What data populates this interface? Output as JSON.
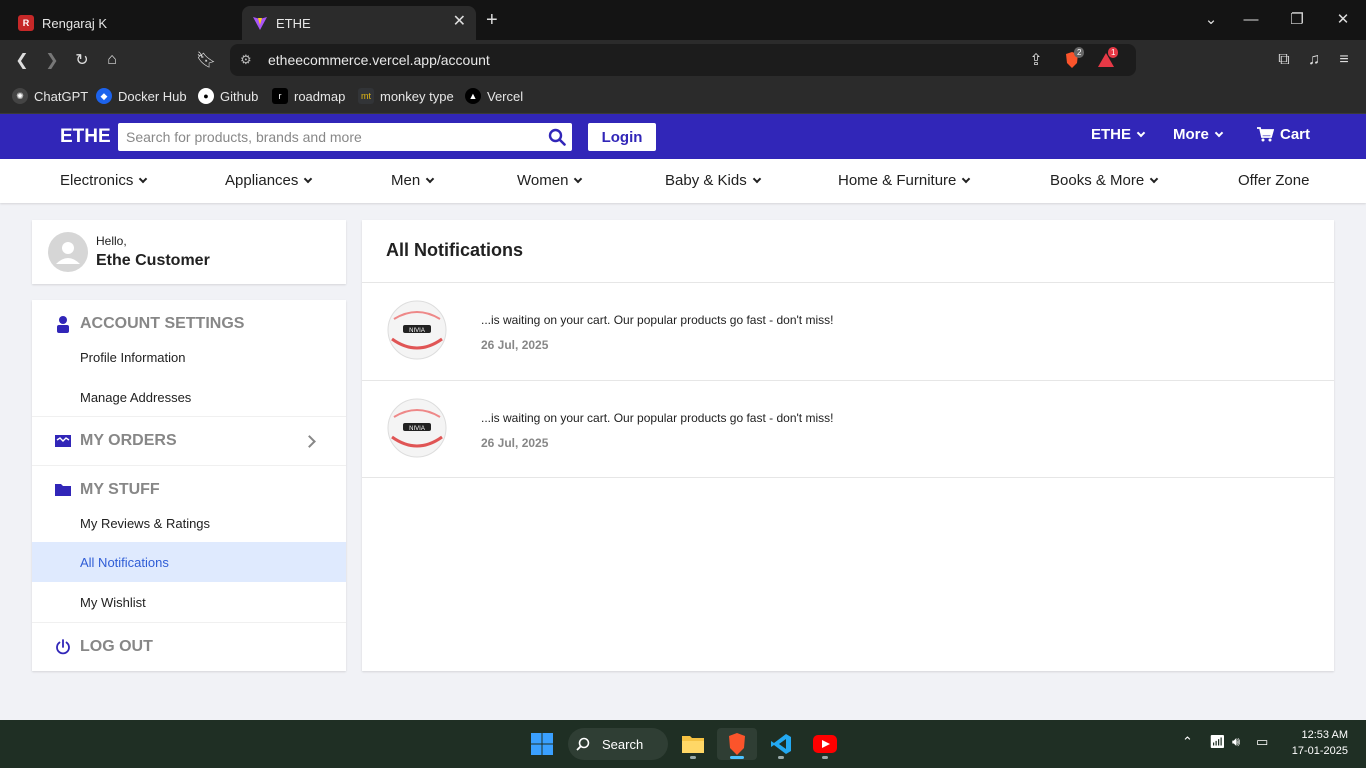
{
  "browser": {
    "tabs": [
      {
        "title": "Rengaraj K",
        "favicon": "red-r-icon"
      },
      {
        "title": "ETHE",
        "favicon": "vite-icon"
      }
    ],
    "url": "etheecommerce.vercel.app/account",
    "shields_count": "2",
    "rewards_count": "1",
    "bookmarks": [
      "ChatGPT",
      "Docker Hub",
      "Github",
      "roadmap",
      "monkey type",
      "Vercel"
    ]
  },
  "header": {
    "logo": "ETHE",
    "search_placeholder": "Search for products, brands and more",
    "login": "Login",
    "ethe_menu": "ETHE",
    "more_menu": "More",
    "cart": "Cart",
    "brand_color": "#3126b8"
  },
  "categories": [
    "Electronics",
    "Appliances",
    "Men",
    "Women",
    "Baby & Kids",
    "Home & Furniture",
    "Books & More",
    "Offer Zone"
  ],
  "sidebar": {
    "hello": "Hello,",
    "name": "Ethe Customer",
    "account_settings": "ACCOUNT SETTINGS",
    "profile_information": "Profile Information",
    "manage_addresses": "Manage Addresses",
    "my_orders": "MY ORDERS",
    "my_stuff": "MY STUFF",
    "reviews": "My Reviews & Ratings",
    "notifications": "All Notifications",
    "wishlist": "My Wishlist",
    "logout": "LOG OUT"
  },
  "main": {
    "title": "All Notifications",
    "notifications": [
      {
        "text": "...is waiting on your cart. Our popular products go fast - don't miss!",
        "date": "26 Jul, 2025",
        "image": "football-icon"
      },
      {
        "text": "...is waiting on your cart. Our popular products go fast - don't miss!",
        "date": "26 Jul, 2025",
        "image": "football-icon"
      }
    ]
  },
  "taskbar": {
    "search": "Search",
    "time": "12:53 AM",
    "date": "17-01-2025"
  }
}
